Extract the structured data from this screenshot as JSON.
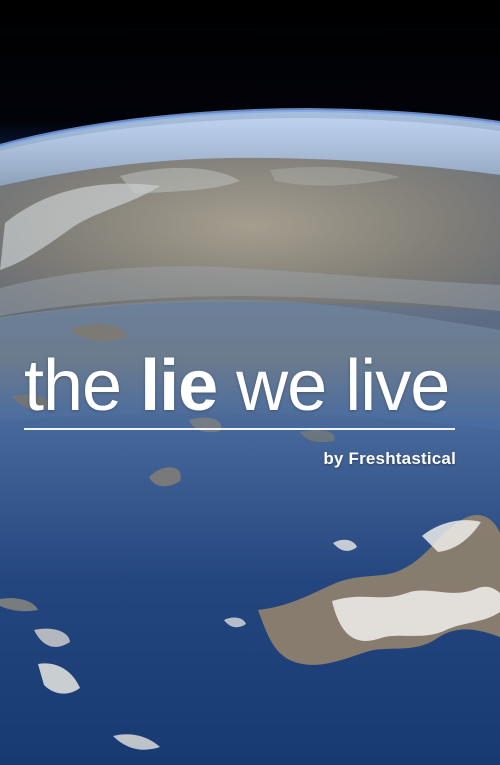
{
  "poster": {
    "title": {
      "part1": "the ",
      "emphasis": "lie",
      "part2": " we live"
    },
    "byline": "by Freshtastical"
  },
  "colors": {
    "space": "#02030a",
    "atmosphere": "#4d78b8",
    "ocean_light": "#365c96",
    "ocean_deep": "#213f78",
    "land": "#8e8676",
    "cloud": "#f4f4f4",
    "text": "#ffffff"
  }
}
